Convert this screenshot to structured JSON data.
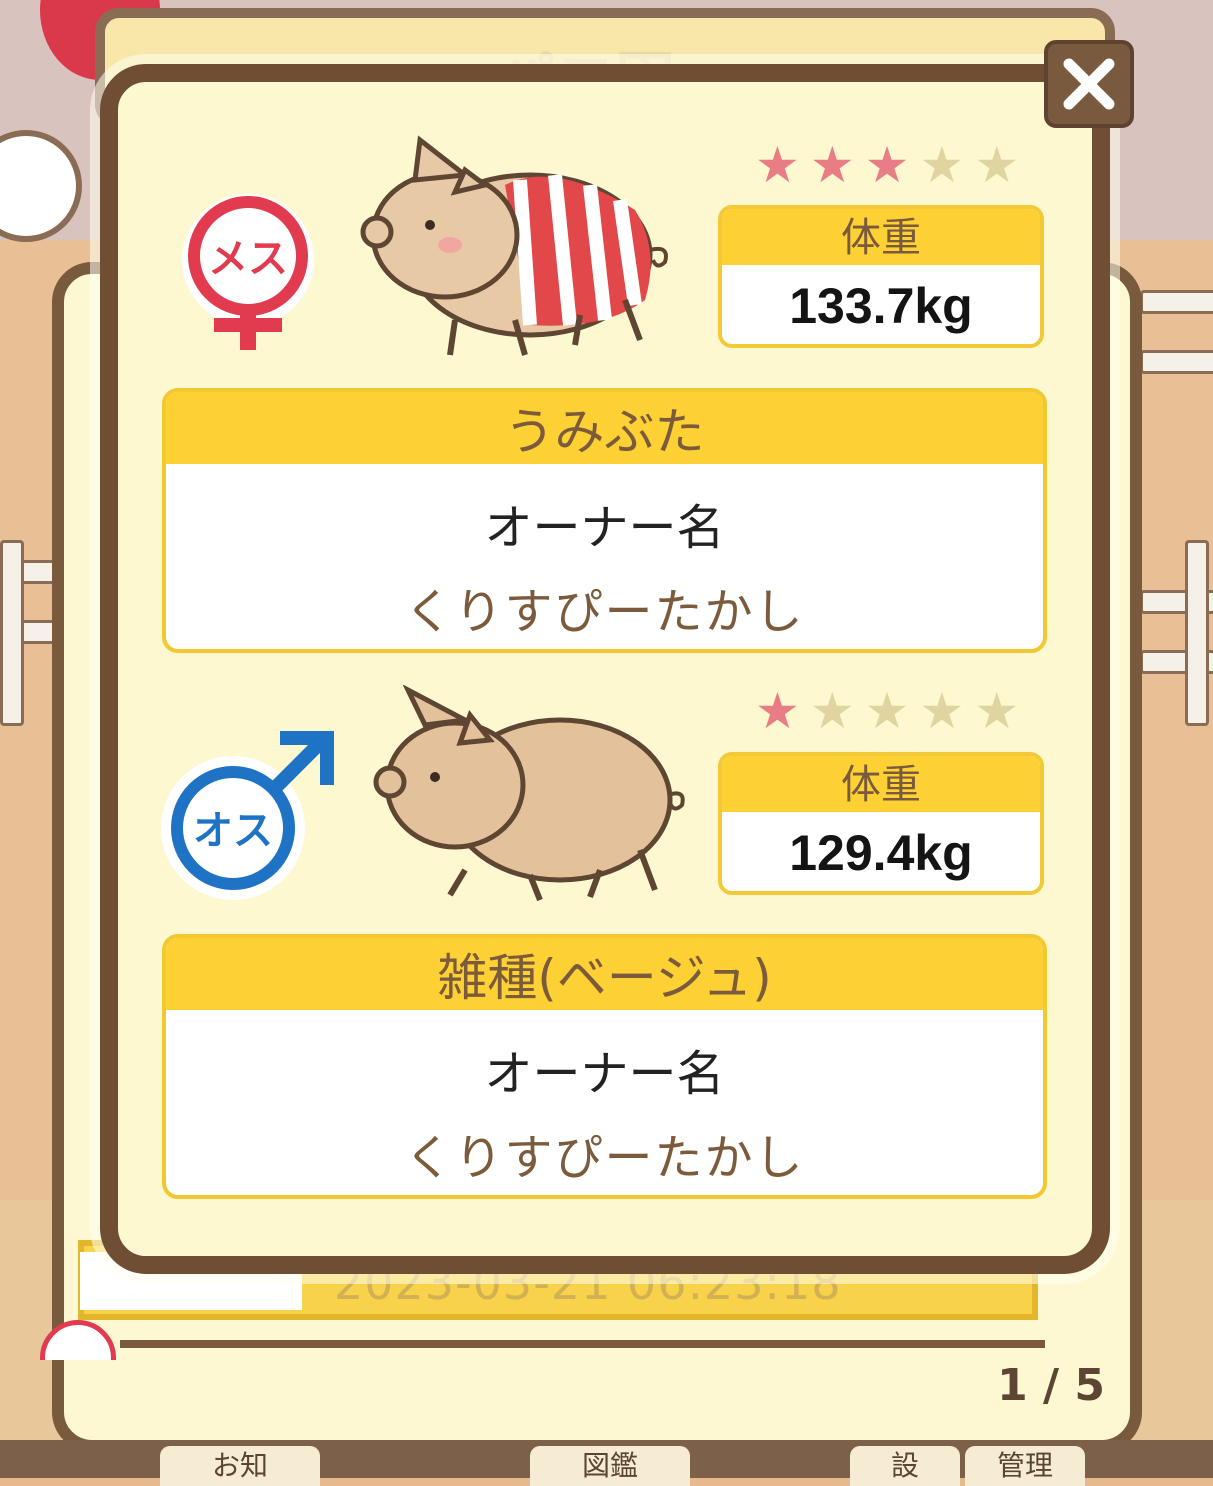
{
  "background": {
    "title_partial": "パコ図",
    "list_row": {
      "datetime": "2023-03-21 06:23:18"
    },
    "bottom_tabs": [
      "お知",
      "図鑑",
      "設",
      "管理"
    ]
  },
  "pagination": "1 / 5",
  "colors": {
    "modal_border": "#6f4e33",
    "modal_bg": "#fdf8d0",
    "header_yellow": "#fdd133",
    "female_red": "#e23a4e",
    "male_blue": "#1f73c4",
    "star_on": "#e87d86",
    "star_off": "#e0d5a0"
  },
  "pigs": [
    {
      "gender": "メス",
      "gender_icon": "female-icon",
      "stars": {
        "filled": 3,
        "total": 5
      },
      "weight_label": "体重",
      "weight": "133.7kg",
      "breed": "うみぶた",
      "owner_label": "オーナー名",
      "owner": "くりすぴーたかし"
    },
    {
      "gender": "オス",
      "gender_icon": "male-icon",
      "stars": {
        "filled": 1,
        "total": 5
      },
      "weight_label": "体重",
      "weight": "129.4kg",
      "breed": "雑種(ベージュ)",
      "owner_label": "オーナー名",
      "owner": "くりすぴーたかし"
    }
  ]
}
